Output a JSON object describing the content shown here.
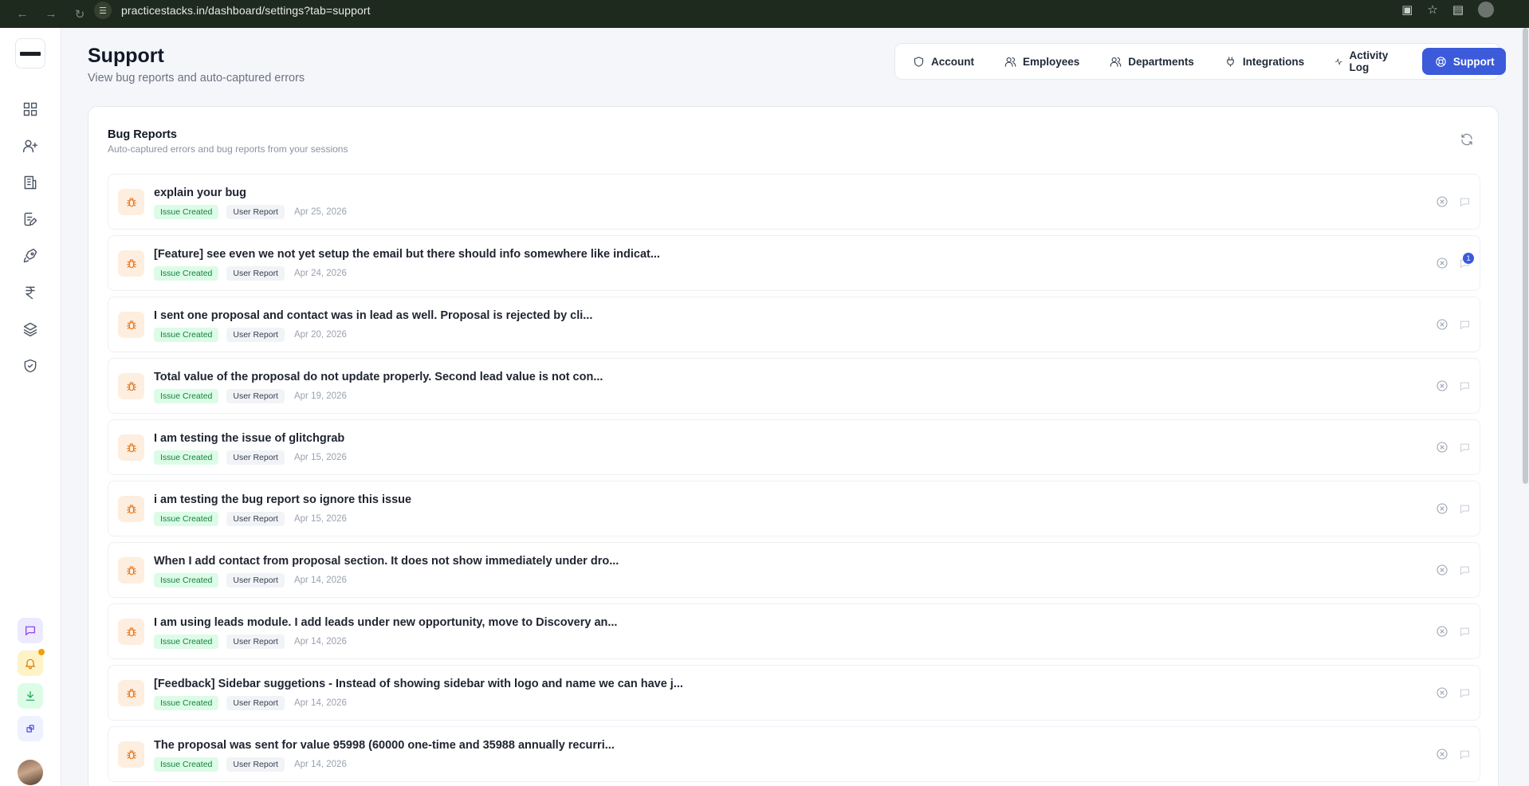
{
  "browser": {
    "url": "practicestacks.in/dashboard/settings?tab=support"
  },
  "header": {
    "title": "Support",
    "subtitle": "View bug reports and auto-captured errors"
  },
  "tabs": [
    {
      "label": "Account",
      "icon": "shield-icon"
    },
    {
      "label": "Employees",
      "icon": "users-icon"
    },
    {
      "label": "Departments",
      "icon": "users-icon"
    },
    {
      "label": "Integrations",
      "icon": "plug-icon"
    },
    {
      "label": "Activity Log",
      "icon": "activity-icon"
    },
    {
      "label": "Support",
      "icon": "lifebuoy-icon",
      "active": true
    }
  ],
  "card": {
    "title": "Bug Reports",
    "subtitle": "Auto-captured errors and bug reports from your sessions"
  },
  "reports": [
    {
      "title": "explain your bug",
      "status": "Issue Created",
      "source": "User Report",
      "date": "Apr 25, 2026"
    },
    {
      "title": "[Feature] see even we not yet setup the email but there should info somewhere like indicat...",
      "status": "Issue Created",
      "source": "User Report",
      "date": "Apr 24, 2026",
      "comments": "1"
    },
    {
      "title": "I sent one proposal and contact was in lead as well. Proposal is rejected by cli...",
      "status": "Issue Created",
      "source": "User Report",
      "date": "Apr 20, 2026"
    },
    {
      "title": "Total value of the proposal do not update properly. Second lead value is not con...",
      "status": "Issue Created",
      "source": "User Report",
      "date": "Apr 19, 2026"
    },
    {
      "title": "I am testing the issue of glitchgrab",
      "status": "Issue Created",
      "source": "User Report",
      "date": "Apr 15, 2026"
    },
    {
      "title": "i am testing the bug report so ignore this issue",
      "status": "Issue Created",
      "source": "User Report",
      "date": "Apr 15, 2026"
    },
    {
      "title": "When I add contact from proposal section. It does not show immediately under dro...",
      "status": "Issue Created",
      "source": "User Report",
      "date": "Apr 14, 2026"
    },
    {
      "title": "I am using leads module. I add leads under new opportunity, move to Discovery an...",
      "status": "Issue Created",
      "source": "User Report",
      "date": "Apr 14, 2026"
    },
    {
      "title": "[Feedback] Sidebar suggetions - Instead of showing sidebar with logo and name we can have j...",
      "status": "Issue Created",
      "source": "User Report",
      "date": "Apr 14, 2026"
    },
    {
      "title": "The proposal was sent for value 95998 (60000 one-time and 35988 annually recurri...",
      "status": "Issue Created",
      "source": "User Report",
      "date": "Apr 14, 2026"
    }
  ],
  "sidebar": {
    "items": [
      {
        "icon": "dashboard-icon"
      },
      {
        "icon": "user-plus-icon"
      },
      {
        "icon": "building-icon"
      },
      {
        "icon": "file-edit-icon"
      },
      {
        "icon": "rocket-icon"
      },
      {
        "icon": "rupee-icon"
      },
      {
        "icon": "layers-icon"
      },
      {
        "icon": "shield-check-icon"
      }
    ]
  },
  "colors": {
    "accent": "#3b5bdb",
    "status_green": "#15803d",
    "bug_orange": "#e8751a"
  }
}
